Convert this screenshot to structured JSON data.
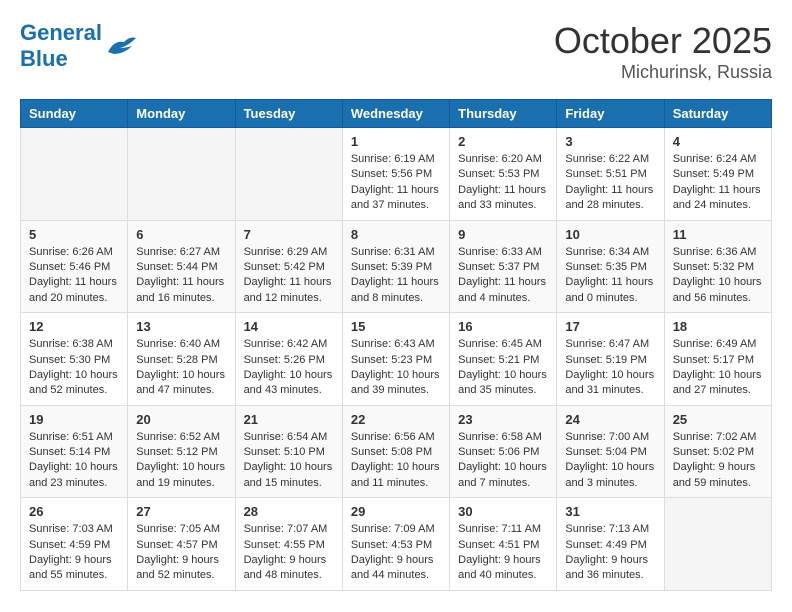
{
  "header": {
    "logo_line1": "General",
    "logo_line2": "Blue",
    "month": "October 2025",
    "location": "Michurinsk, Russia"
  },
  "days_of_week": [
    "Sunday",
    "Monday",
    "Tuesday",
    "Wednesday",
    "Thursday",
    "Friday",
    "Saturday"
  ],
  "weeks": [
    [
      {
        "date": "",
        "sunrise": "",
        "sunset": "",
        "daylight": ""
      },
      {
        "date": "",
        "sunrise": "",
        "sunset": "",
        "daylight": ""
      },
      {
        "date": "",
        "sunrise": "",
        "sunset": "",
        "daylight": ""
      },
      {
        "date": "1",
        "sunrise": "Sunrise: 6:19 AM",
        "sunset": "Sunset: 5:56 PM",
        "daylight": "Daylight: 11 hours and 37 minutes."
      },
      {
        "date": "2",
        "sunrise": "Sunrise: 6:20 AM",
        "sunset": "Sunset: 5:53 PM",
        "daylight": "Daylight: 11 hours and 33 minutes."
      },
      {
        "date": "3",
        "sunrise": "Sunrise: 6:22 AM",
        "sunset": "Sunset: 5:51 PM",
        "daylight": "Daylight: 11 hours and 28 minutes."
      },
      {
        "date": "4",
        "sunrise": "Sunrise: 6:24 AM",
        "sunset": "Sunset: 5:49 PM",
        "daylight": "Daylight: 11 hours and 24 minutes."
      }
    ],
    [
      {
        "date": "5",
        "sunrise": "Sunrise: 6:26 AM",
        "sunset": "Sunset: 5:46 PM",
        "daylight": "Daylight: 11 hours and 20 minutes."
      },
      {
        "date": "6",
        "sunrise": "Sunrise: 6:27 AM",
        "sunset": "Sunset: 5:44 PM",
        "daylight": "Daylight: 11 hours and 16 minutes."
      },
      {
        "date": "7",
        "sunrise": "Sunrise: 6:29 AM",
        "sunset": "Sunset: 5:42 PM",
        "daylight": "Daylight: 11 hours and 12 minutes."
      },
      {
        "date": "8",
        "sunrise": "Sunrise: 6:31 AM",
        "sunset": "Sunset: 5:39 PM",
        "daylight": "Daylight: 11 hours and 8 minutes."
      },
      {
        "date": "9",
        "sunrise": "Sunrise: 6:33 AM",
        "sunset": "Sunset: 5:37 PM",
        "daylight": "Daylight: 11 hours and 4 minutes."
      },
      {
        "date": "10",
        "sunrise": "Sunrise: 6:34 AM",
        "sunset": "Sunset: 5:35 PM",
        "daylight": "Daylight: 11 hours and 0 minutes."
      },
      {
        "date": "11",
        "sunrise": "Sunrise: 6:36 AM",
        "sunset": "Sunset: 5:32 PM",
        "daylight": "Daylight: 10 hours and 56 minutes."
      }
    ],
    [
      {
        "date": "12",
        "sunrise": "Sunrise: 6:38 AM",
        "sunset": "Sunset: 5:30 PM",
        "daylight": "Daylight: 10 hours and 52 minutes."
      },
      {
        "date": "13",
        "sunrise": "Sunrise: 6:40 AM",
        "sunset": "Sunset: 5:28 PM",
        "daylight": "Daylight: 10 hours and 47 minutes."
      },
      {
        "date": "14",
        "sunrise": "Sunrise: 6:42 AM",
        "sunset": "Sunset: 5:26 PM",
        "daylight": "Daylight: 10 hours and 43 minutes."
      },
      {
        "date": "15",
        "sunrise": "Sunrise: 6:43 AM",
        "sunset": "Sunset: 5:23 PM",
        "daylight": "Daylight: 10 hours and 39 minutes."
      },
      {
        "date": "16",
        "sunrise": "Sunrise: 6:45 AM",
        "sunset": "Sunset: 5:21 PM",
        "daylight": "Daylight: 10 hours and 35 minutes."
      },
      {
        "date": "17",
        "sunrise": "Sunrise: 6:47 AM",
        "sunset": "Sunset: 5:19 PM",
        "daylight": "Daylight: 10 hours and 31 minutes."
      },
      {
        "date": "18",
        "sunrise": "Sunrise: 6:49 AM",
        "sunset": "Sunset: 5:17 PM",
        "daylight": "Daylight: 10 hours and 27 minutes."
      }
    ],
    [
      {
        "date": "19",
        "sunrise": "Sunrise: 6:51 AM",
        "sunset": "Sunset: 5:14 PM",
        "daylight": "Daylight: 10 hours and 23 minutes."
      },
      {
        "date": "20",
        "sunrise": "Sunrise: 6:52 AM",
        "sunset": "Sunset: 5:12 PM",
        "daylight": "Daylight: 10 hours and 19 minutes."
      },
      {
        "date": "21",
        "sunrise": "Sunrise: 6:54 AM",
        "sunset": "Sunset: 5:10 PM",
        "daylight": "Daylight: 10 hours and 15 minutes."
      },
      {
        "date": "22",
        "sunrise": "Sunrise: 6:56 AM",
        "sunset": "Sunset: 5:08 PM",
        "daylight": "Daylight: 10 hours and 11 minutes."
      },
      {
        "date": "23",
        "sunrise": "Sunrise: 6:58 AM",
        "sunset": "Sunset: 5:06 PM",
        "daylight": "Daylight: 10 hours and 7 minutes."
      },
      {
        "date": "24",
        "sunrise": "Sunrise: 7:00 AM",
        "sunset": "Sunset: 5:04 PM",
        "daylight": "Daylight: 10 hours and 3 minutes."
      },
      {
        "date": "25",
        "sunrise": "Sunrise: 7:02 AM",
        "sunset": "Sunset: 5:02 PM",
        "daylight": "Daylight: 9 hours and 59 minutes."
      }
    ],
    [
      {
        "date": "26",
        "sunrise": "Sunrise: 7:03 AM",
        "sunset": "Sunset: 4:59 PM",
        "daylight": "Daylight: 9 hours and 55 minutes."
      },
      {
        "date": "27",
        "sunrise": "Sunrise: 7:05 AM",
        "sunset": "Sunset: 4:57 PM",
        "daylight": "Daylight: 9 hours and 52 minutes."
      },
      {
        "date": "28",
        "sunrise": "Sunrise: 7:07 AM",
        "sunset": "Sunset: 4:55 PM",
        "daylight": "Daylight: 9 hours and 48 minutes."
      },
      {
        "date": "29",
        "sunrise": "Sunrise: 7:09 AM",
        "sunset": "Sunset: 4:53 PM",
        "daylight": "Daylight: 9 hours and 44 minutes."
      },
      {
        "date": "30",
        "sunrise": "Sunrise: 7:11 AM",
        "sunset": "Sunset: 4:51 PM",
        "daylight": "Daylight: 9 hours and 40 minutes."
      },
      {
        "date": "31",
        "sunrise": "Sunrise: 7:13 AM",
        "sunset": "Sunset: 4:49 PM",
        "daylight": "Daylight: 9 hours and 36 minutes."
      },
      {
        "date": "",
        "sunrise": "",
        "sunset": "",
        "daylight": ""
      }
    ]
  ]
}
